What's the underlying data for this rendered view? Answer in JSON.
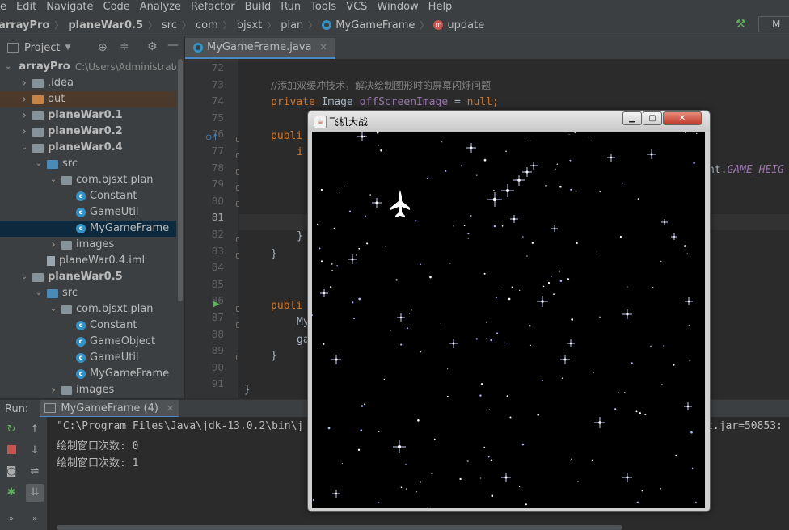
{
  "menu": [
    "e",
    "Edit",
    "Navigate",
    "Code",
    "Analyze",
    "Refactor",
    "Build",
    "Run",
    "Tools",
    "VCS",
    "Window",
    "Help"
  ],
  "breadcrumb": {
    "project": "arrayPro",
    "module": "planeWar0.5",
    "src": "src",
    "pkg1": "com",
    "pkg2": "bjsxt",
    "pkg3": "plan",
    "cls": "MyGameFrame",
    "method": "update",
    "right_label": "M"
  },
  "project_panel": {
    "title": "Project",
    "tree": [
      {
        "text": "arrayPro",
        "path": "C:\\Users\\Administrato",
        "indent": 0,
        "arrow": "down",
        "icon": "folder",
        "bold": true
      },
      {
        "text": ".idea",
        "indent": 1,
        "arrow": "right",
        "icon": "folder"
      },
      {
        "text": "out",
        "indent": 1,
        "arrow": "right",
        "icon": "folder-orange",
        "hl": true
      },
      {
        "text": "planeWar0.1",
        "indent": 1,
        "arrow": "right",
        "icon": "folder",
        "bold": true
      },
      {
        "text": "planeWar0.2",
        "indent": 1,
        "arrow": "right",
        "icon": "folder",
        "bold": true
      },
      {
        "text": "planeWar0.4",
        "indent": 1,
        "arrow": "down",
        "icon": "folder",
        "bold": true
      },
      {
        "text": "src",
        "indent": 2,
        "arrow": "down",
        "icon": "folder-blue"
      },
      {
        "text": "com.bjsxt.plan",
        "indent": 3,
        "arrow": "down",
        "icon": "pkg"
      },
      {
        "text": "Constant",
        "indent": 4,
        "arrow": "",
        "icon": "class"
      },
      {
        "text": "GameUtil",
        "indent": 4,
        "arrow": "",
        "icon": "class"
      },
      {
        "text": "MyGameFrame",
        "indent": 4,
        "arrow": "",
        "icon": "class",
        "sel": true
      },
      {
        "text": "images",
        "indent": 3,
        "arrow": "right",
        "icon": "pkg"
      },
      {
        "text": "planeWar0.4.iml",
        "indent": 2,
        "arrow": "",
        "icon": "file"
      },
      {
        "text": "planeWar0.5",
        "indent": 1,
        "arrow": "down",
        "icon": "folder",
        "bold": true
      },
      {
        "text": "src",
        "indent": 2,
        "arrow": "down",
        "icon": "folder-blue"
      },
      {
        "text": "com.bjsxt.plan",
        "indent": 3,
        "arrow": "down",
        "icon": "pkg"
      },
      {
        "text": "Constant",
        "indent": 4,
        "arrow": "",
        "icon": "class"
      },
      {
        "text": "GameObject",
        "indent": 4,
        "arrow": "",
        "icon": "class"
      },
      {
        "text": "GameUtil",
        "indent": 4,
        "arrow": "",
        "icon": "class"
      },
      {
        "text": "MyGameFrame",
        "indent": 4,
        "arrow": "",
        "icon": "class"
      },
      {
        "text": "images",
        "indent": 3,
        "arrow": "right",
        "icon": "pkg"
      }
    ]
  },
  "editor": {
    "tab_label": "MyGameFrame.java",
    "line_numbers": [
      "72",
      "73",
      "74",
      "75",
      "76",
      "77",
      "78",
      "79",
      "80",
      "81",
      "82",
      "83",
      "84",
      "85",
      "86",
      "87",
      "88",
      "89",
      "90",
      "91"
    ],
    "current_line": "81",
    "code": {
      "l73": "//添加双缓冲技术，解决绘制图形时的屏幕闪烁问题",
      "l74_kw": "private",
      "l74_type": " Image ",
      "l74_field": "offScreenImage",
      "l74_eq": " = ",
      "l74_null": "null;",
      "l76": "publi",
      "l77": "i",
      "l78_tail": "nt.",
      "l78_const": "GAME_HEIG",
      "l82": "}",
      "l83": "}",
      "l86": "publi",
      "l87": "My",
      "l88": "ga",
      "l89": "}",
      "l91": "}"
    }
  },
  "run_panel": {
    "label": "Run:",
    "tab": "MyGameFrame (4)",
    "lines": [
      "\"C:\\Program Files\\Java\\jdk-13.0.2\\bin\\j",
      "绘制窗口次数: 0",
      "绘制窗口次数: 1"
    ],
    "line1_tail": "t.jar=50853:"
  },
  "game_window": {
    "title": "飞机大战",
    "icon": "java-icon"
  }
}
